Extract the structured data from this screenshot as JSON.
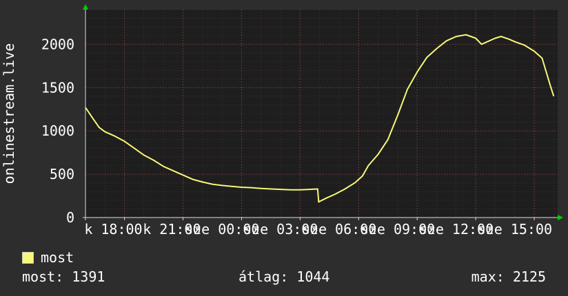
{
  "chart_data": {
    "type": "line",
    "ylabel": "onlinestream.live",
    "ylim": [
      0,
      2400
    ],
    "yticks": [
      0,
      500,
      1000,
      1500,
      2000
    ],
    "x_tick_labels": [
      "k 18:00",
      "k 21:00",
      "sze 00:00",
      "sze 03:00",
      "sze 06:00",
      "sze 09:00",
      "sze 12:00",
      "sze 15:00"
    ],
    "x_range_hours": [
      16,
      40.2
    ],
    "grid": true,
    "colors": {
      "background": "#2d2d2d",
      "plot_background": "#1e1e1e",
      "grid": "#6e3a3a",
      "line": "#f8f878",
      "axis_arrow": "#00cc00"
    },
    "series": [
      {
        "name": "most",
        "x": [
          16.0,
          16.3,
          16.7,
          17.0,
          17.5,
          18.0,
          18.5,
          19.0,
          19.5,
          20.0,
          20.5,
          21.0,
          21.5,
          22.0,
          22.5,
          23.0,
          23.5,
          24.0,
          24.5,
          25.0,
          25.5,
          26.0,
          26.5,
          27.0,
          27.5,
          27.9,
          27.95,
          28.3,
          28.8,
          29.3,
          29.8,
          30.2,
          30.5,
          31.0,
          31.5,
          32.0,
          32.5,
          33.0,
          33.5,
          34.0,
          34.5,
          35.0,
          35.5,
          36.0,
          36.3,
          36.7,
          37.0,
          37.3,
          37.7,
          38.0,
          38.5,
          39.0,
          39.4,
          39.8,
          40.0
        ],
        "values": [
          1270,
          1170,
          1040,
          990,
          940,
          880,
          800,
          720,
          660,
          590,
          540,
          490,
          440,
          410,
          385,
          370,
          360,
          350,
          345,
          335,
          330,
          325,
          320,
          320,
          325,
          330,
          180,
          220,
          270,
          330,
          400,
          480,
          600,
          730,
          900,
          1180,
          1480,
          1680,
          1850,
          1950,
          2040,
          2090,
          2110,
          2070,
          2000,
          2040,
          2070,
          2090,
          2060,
          2030,
          1990,
          1920,
          1840,
          1540,
          1400
        ]
      }
    ]
  },
  "legend": {
    "label": "most",
    "color": "#f8f878"
  },
  "stats": {
    "current": "most: 1391",
    "average": "átlag: 1044",
    "max": "max: 2125"
  }
}
